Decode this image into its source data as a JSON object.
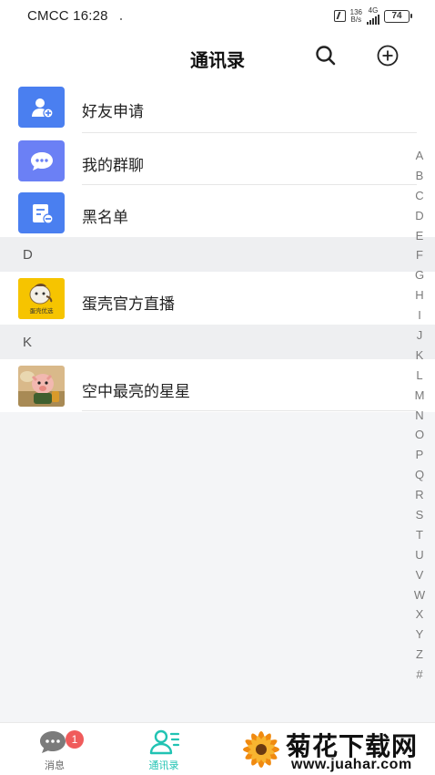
{
  "status_bar": {
    "carrier_time": "CMCC 16:28",
    "speed_top": "136",
    "speed_bottom": "B/s",
    "network": "4G",
    "battery": "74"
  },
  "header": {
    "title": "通讯录"
  },
  "features": [
    {
      "label": "好友申请",
      "icon": "add-friend-icon",
      "color": "#4a7ff0"
    },
    {
      "label": "我的群聊",
      "icon": "group-chat-icon",
      "color": "#6b80f5"
    },
    {
      "label": "黑名单",
      "icon": "blacklist-icon",
      "color": "#4a7ff0"
    }
  ],
  "sections": [
    {
      "letter": "D",
      "contacts": [
        {
          "name": "蛋壳官方直播",
          "avatar_text": "蛋壳优选"
        }
      ]
    },
    {
      "letter": "K",
      "contacts": [
        {
          "name": "空中最亮的星星"
        }
      ]
    }
  ],
  "alphabet": [
    "A",
    "B",
    "C",
    "D",
    "E",
    "F",
    "G",
    "H",
    "I",
    "J",
    "K",
    "L",
    "M",
    "N",
    "O",
    "P",
    "Q",
    "R",
    "S",
    "T",
    "U",
    "V",
    "W",
    "X",
    "Y",
    "Z",
    "#"
  ],
  "bottom_nav": {
    "messages_label": "消息",
    "messages_badge": "1",
    "contacts_label": "通讯录"
  },
  "watermark": {
    "title": "菊花下载网",
    "url": "www.juahar.com"
  },
  "colors": {
    "accent": "#21c3b3",
    "badge": "#f05b5b",
    "feature_blue": "#4a7ff0"
  }
}
